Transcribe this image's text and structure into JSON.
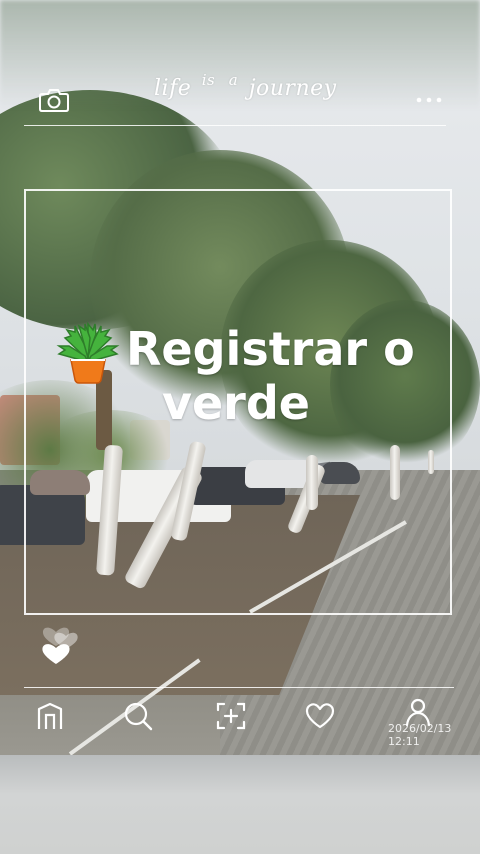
{
  "header": {
    "title_words": [
      "life",
      "is",
      "a",
      "journey"
    ],
    "camera_icon": "camera-icon",
    "menu_icon": "more-dots-icon"
  },
  "main": {
    "headline_line1": "Registrar o",
    "headline_line2": "verde",
    "plant_icon": "potted-plant-icon",
    "hearts_icon": "hearts-icon"
  },
  "bottom_nav": {
    "icons": [
      "home-icon",
      "search-icon",
      "add-frame-icon",
      "heart-icon",
      "profile-icon"
    ],
    "timestamp": "2026/02/13 12:11"
  },
  "colors": {
    "overlay": "#ffffff",
    "plant_leaf": "#3fa535",
    "plant_pot": "#f07a1a"
  }
}
